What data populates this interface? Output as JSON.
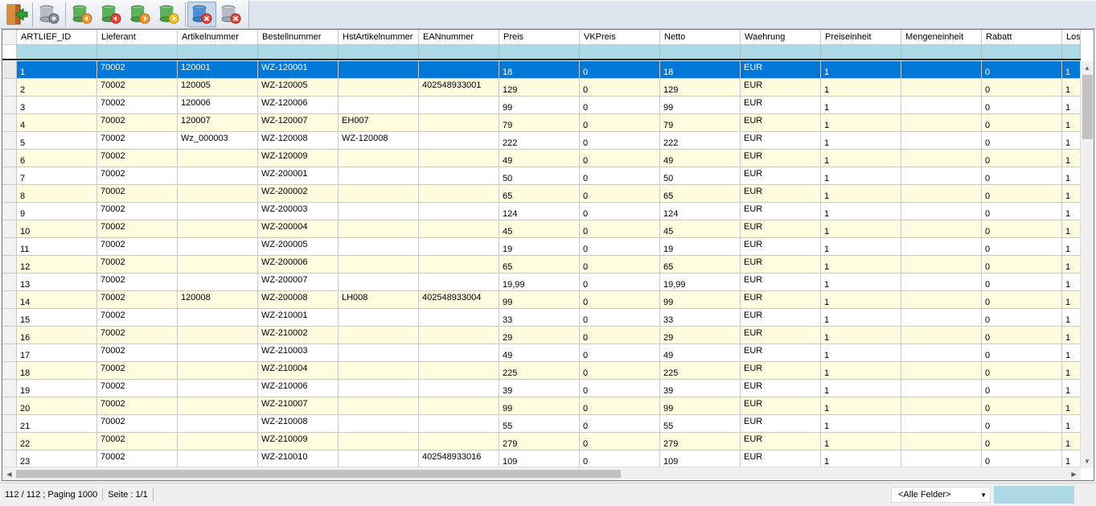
{
  "toolbar": {
    "buttons": [
      {
        "name": "exit-button",
        "icon": "exit-door-icon"
      },
      {
        "name": "database-settings-button",
        "icon": "database-gear-icon"
      },
      {
        "name": "first-record-button",
        "icon": "database-first-icon"
      },
      {
        "name": "previous-record-button",
        "icon": "database-prev-icon"
      },
      {
        "name": "next-record-button",
        "icon": "database-next-icon"
      },
      {
        "name": "last-record-button",
        "icon": "database-last-icon"
      },
      {
        "name": "delete-record-button",
        "icon": "database-delete-icon"
      },
      {
        "name": "cancel-button",
        "icon": "database-cancel-icon"
      }
    ]
  },
  "grid": {
    "columns": [
      "ARTLIEF_ID",
      "Lieferant",
      "Artikelnummer",
      "Bestellnummer",
      "HstArtikelnummer",
      "EANnummer",
      "Preis",
      "VKPreis",
      "Netto",
      "Waehrung",
      "Preiseinheit",
      "Mengeneinheit",
      "Rabatt",
      "Los"
    ],
    "rows": [
      [
        "1",
        "70002",
        "120001",
        "WZ-120001",
        "",
        "",
        "18",
        "0",
        "18",
        "EUR",
        "1",
        "",
        "0",
        "1"
      ],
      [
        "2",
        "70002",
        "120005",
        "WZ-120005",
        "",
        "402548933001",
        "129",
        "0",
        "129",
        "EUR",
        "1",
        "",
        "0",
        "1"
      ],
      [
        "3",
        "70002",
        "120006",
        "WZ-120006",
        "",
        "",
        "99",
        "0",
        "99",
        "EUR",
        "1",
        "",
        "0",
        "1"
      ],
      [
        "4",
        "70002",
        "120007",
        "WZ-120007",
        "EH007",
        "",
        "79",
        "0",
        "79",
        "EUR",
        "1",
        "",
        "0",
        "1"
      ],
      [
        "5",
        "70002",
        "Wz_000003",
        "WZ-120008",
        "WZ-120008",
        "",
        "222",
        "0",
        "222",
        "EUR",
        "1",
        "",
        "0",
        "1"
      ],
      [
        "6",
        "70002",
        "",
        "WZ-120009",
        "",
        "",
        "49",
        "0",
        "49",
        "EUR",
        "1",
        "",
        "0",
        "1"
      ],
      [
        "7",
        "70002",
        "",
        "WZ-200001",
        "",
        "",
        "50",
        "0",
        "50",
        "EUR",
        "1",
        "",
        "0",
        "1"
      ],
      [
        "8",
        "70002",
        "",
        "WZ-200002",
        "",
        "",
        "65",
        "0",
        "65",
        "EUR",
        "1",
        "",
        "0",
        "1"
      ],
      [
        "9",
        "70002",
        "",
        "WZ-200003",
        "",
        "",
        "124",
        "0",
        "124",
        "EUR",
        "1",
        "",
        "0",
        "1"
      ],
      [
        "10",
        "70002",
        "",
        "WZ-200004",
        "",
        "",
        "45",
        "0",
        "45",
        "EUR",
        "1",
        "",
        "0",
        "1"
      ],
      [
        "11",
        "70002",
        "",
        "WZ-200005",
        "",
        "",
        "19",
        "0",
        "19",
        "EUR",
        "1",
        "",
        "0",
        "1"
      ],
      [
        "12",
        "70002",
        "",
        "WZ-200006",
        "",
        "",
        "65",
        "0",
        "65",
        "EUR",
        "1",
        "",
        "0",
        "1"
      ],
      [
        "13",
        "70002",
        "",
        "WZ-200007",
        "",
        "",
        "19,99",
        "0",
        "19,99",
        "EUR",
        "1",
        "",
        "0",
        "1"
      ],
      [
        "14",
        "70002",
        "120008",
        "WZ-200008",
        "LH008",
        "402548933004",
        "99",
        "0",
        "99",
        "EUR",
        "1",
        "",
        "0",
        "1"
      ],
      [
        "15",
        "70002",
        "",
        "WZ-210001",
        "",
        "",
        "33",
        "0",
        "33",
        "EUR",
        "1",
        "",
        "0",
        "1"
      ],
      [
        "16",
        "70002",
        "",
        "WZ-210002",
        "",
        "",
        "29",
        "0",
        "29",
        "EUR",
        "1",
        "",
        "0",
        "1"
      ],
      [
        "17",
        "70002",
        "",
        "WZ-210003",
        "",
        "",
        "49",
        "0",
        "49",
        "EUR",
        "1",
        "",
        "0",
        "1"
      ],
      [
        "18",
        "70002",
        "",
        "WZ-210004",
        "",
        "",
        "225",
        "0",
        "225",
        "EUR",
        "1",
        "",
        "0",
        "1"
      ],
      [
        "19",
        "70002",
        "",
        "WZ-210006",
        "",
        "",
        "39",
        "0",
        "39",
        "EUR",
        "1",
        "",
        "0",
        "1"
      ],
      [
        "20",
        "70002",
        "",
        "WZ-210007",
        "",
        "",
        "99",
        "0",
        "99",
        "EUR",
        "1",
        "",
        "0",
        "1"
      ],
      [
        "21",
        "70002",
        "",
        "WZ-210008",
        "",
        "",
        "55",
        "0",
        "55",
        "EUR",
        "1",
        "",
        "0",
        "1"
      ],
      [
        "22",
        "70002",
        "",
        "WZ-210009",
        "",
        "",
        "279",
        "0",
        "279",
        "EUR",
        "1",
        "",
        "0",
        "1"
      ],
      [
        "23",
        "70002",
        "",
        "WZ-210010",
        "",
        "402548933016",
        "109",
        "0",
        "109",
        "EUR",
        "1",
        "",
        "0",
        "1"
      ]
    ],
    "selected_row": 0
  },
  "status": {
    "record_count": "112 / 112 ; Paging 1000",
    "page": "Seite : 1/1",
    "field_filter": "<Alle Felder>",
    "search_value": ""
  },
  "colors": {
    "selection": "#0078d7",
    "alt_row": "#fffce0",
    "filter_bg": "#add8e6"
  }
}
